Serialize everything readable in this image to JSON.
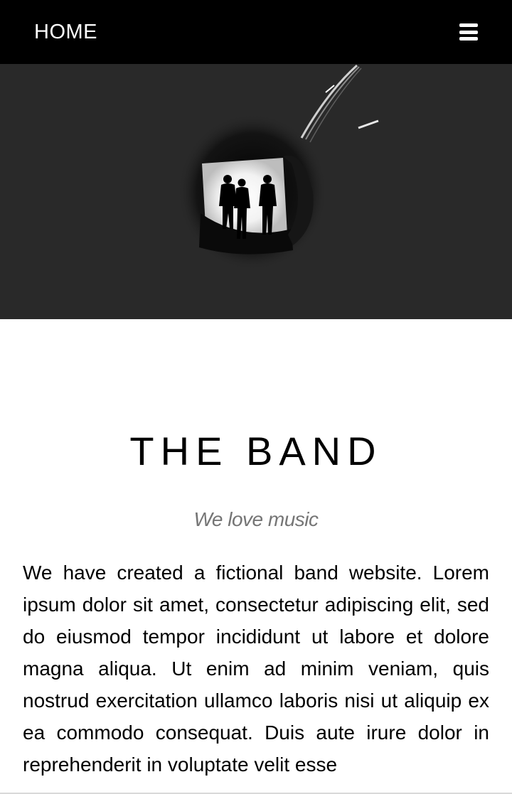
{
  "navbar": {
    "home_label": "HOME",
    "menu_icon": "hamburger-menu-icon",
    "background_color": "#000000",
    "text_color": "#ffffff"
  },
  "hero": {
    "image_description_icon": "band-silhouette-image",
    "background_color": "#292929"
  },
  "main": {
    "title": "THE BAND",
    "tagline": "We love music",
    "description": "We have created a fictional band website. Lorem ipsum dolor sit amet, consectetur adipiscing elit, sed do eiusmod tempor incididunt ut labore et dolore magna aliqua. Ut enim ad minim veniam, quis nostrud exercitation ullamco laboris nisi ut aliquip ex ea commodo consequat. Duis aute irure dolor in reprehenderit in voluptate velit esse"
  }
}
